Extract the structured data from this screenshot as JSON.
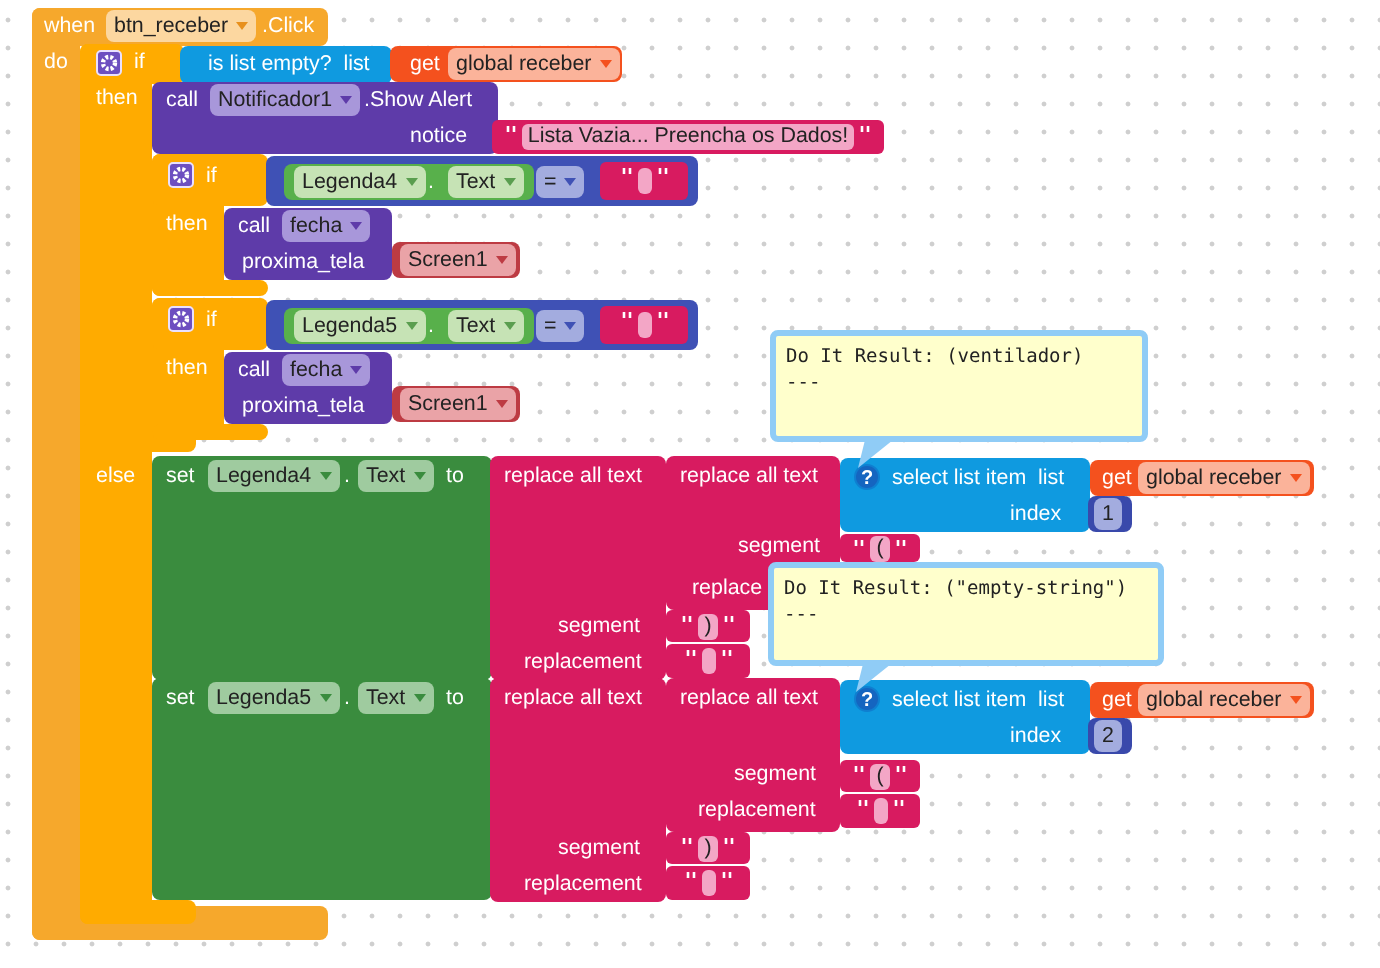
{
  "event": {
    "keyword": "when",
    "component": "btn_receber",
    "event": ".Click",
    "do_label": "do"
  },
  "if_block": {
    "if_label": "if",
    "then_label": "then",
    "else_label": "else",
    "condition": {
      "label": "is list empty?  list",
      "get_label": "get",
      "variable": "global receber"
    }
  },
  "then_alert": {
    "call_label": "call",
    "component": "Notificador1",
    "method": ".Show Alert",
    "arg_label": "notice",
    "value": "Lista Vazia... Preencha os Dados!"
  },
  "nested_ifs": [
    {
      "if_label": "if",
      "then_label": "then",
      "component": "Legenda4",
      "dot": ".",
      "property": "Text",
      "operator": "=",
      "call_label": "call",
      "procedure": "fecha",
      "arg_label": "proxima_tela",
      "screen": "Screen1"
    },
    {
      "if_label": "if",
      "then_label": "then",
      "component": "Legenda5",
      "dot": ".",
      "property": "Text",
      "operator": "=",
      "call_label": "call",
      "procedure": "fecha",
      "arg_label": "proxima_tela",
      "screen": "Screen1"
    }
  ],
  "else_sets": [
    {
      "set_label": "set",
      "component": "Legenda4",
      "dot": ".",
      "property": "Text",
      "to_label": "to",
      "outer_replace": {
        "label": "replace all text",
        "segment_label": "segment",
        "replacement_label": "replacement",
        "segment": ")"
      },
      "inner_replace": {
        "label": "replace all text",
        "segment_label": "segment",
        "replacement_label": "replace",
        "segment": "("
      },
      "select": {
        "help": "?",
        "label": "select list item  list",
        "index_label": "index",
        "get_label": "get",
        "variable": "global receber",
        "index": "1"
      }
    },
    {
      "set_label": "set",
      "component": "Legenda5",
      "dot": ".",
      "property": "Text",
      "to_label": "to",
      "outer_replace": {
        "label": "replace all text",
        "segment_label": "segment",
        "replacement_label": "replacement",
        "segment": ")"
      },
      "inner_replace": {
        "label": "replace all text",
        "segment_label": "segment",
        "replacement_label": "replacement",
        "segment": "("
      },
      "select": {
        "help": "?",
        "label": "select list item  list",
        "index_label": "index",
        "get_label": "get",
        "variable": "global receber",
        "index": "2"
      }
    }
  ],
  "results": [
    {
      "text": "Do It Result: (ventilador)",
      "separator": "---"
    },
    {
      "text": "Do It Result: (\"empty-string\")",
      "separator": "---"
    }
  ]
}
